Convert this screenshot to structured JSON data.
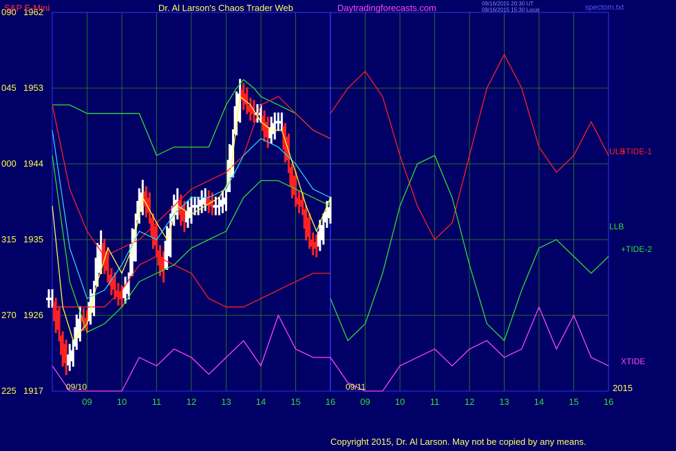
{
  "header": {
    "instrument": "S&P E-Mini",
    "site": "Dr. Al Larson's Chaos Trader Web",
    "url": "Daytradingforecasts.com",
    "timestamp_1": "09/16/2015 20:30 UT",
    "timestamp_2": "09/16/2015 15:30 Local",
    "file": "spectom.txt"
  },
  "footer": {
    "copyright": "Copyright 2015, Dr. Al Larson. May not be copied by any means."
  },
  "colors": {
    "background": "#000066",
    "grid": "#2a6a2a",
    "divider": "#3333ff",
    "price_up": "#ffffff",
    "price_down": "#ff2222",
    "red_line": "#ff2020",
    "green_line": "#33dd33",
    "cyan_line": "#33ccff",
    "yellow_line": "#ffff44",
    "magenta_line": "#ff44ff"
  },
  "chart_data": {
    "type": "line",
    "y_axis": {
      "right_labels": [
        "1962",
        "1953",
        "1944",
        "1935",
        "1926",
        "1917"
      ],
      "left_labels": [
        "090",
        "045",
        "000",
        "315",
        "270",
        "225"
      ],
      "ylim": [
        1917,
        1962
      ]
    },
    "x_axis": {
      "date_labels": [
        "09/10",
        "09/11"
      ],
      "year_label": "2015",
      "hour_labels": [
        "09",
        "10",
        "11",
        "12",
        "13",
        "14",
        "15",
        "16",
        "09",
        "10",
        "11",
        "12",
        "13",
        "14",
        "15",
        "16"
      ]
    },
    "grid": true,
    "right_labels": [
      {
        "text": "ULB",
        "color": "#ff2020"
      },
      {
        "text": "+TIDE-1",
        "color": "#ff2020"
      },
      {
        "text": "LLB",
        "color": "#33dd33"
      },
      {
        "text": "+TIDE-2",
        "color": "#33dd33"
      },
      {
        "text": "XTIDE",
        "color": "#ff44ff"
      }
    ],
    "series": [
      {
        "role": "price",
        "kind": "bars",
        "x": [
          8.0,
          8.2,
          8.4,
          8.6,
          8.8,
          9.0,
          9.2,
          9.4,
          9.6,
          9.8,
          10.0,
          10.2,
          10.4,
          10.6,
          10.8,
          11.0,
          11.2,
          11.4,
          11.6,
          11.8,
          12.0,
          12.2,
          12.4,
          12.6,
          12.8,
          13.0,
          13.2,
          13.4,
          13.6,
          13.8,
          14.0,
          14.2,
          14.4,
          14.6,
          14.8,
          15.0,
          15.2,
          15.4,
          15.6,
          15.8,
          16.0
        ],
        "y": [
          1928,
          1924,
          1920,
          1922,
          1926,
          1925,
          1929,
          1935,
          1931,
          1929,
          1928,
          1930,
          1937,
          1941,
          1938,
          1934,
          1931,
          1937,
          1940,
          1937,
          1939,
          1939,
          1940,
          1939,
          1939,
          1940,
          1947,
          1953,
          1951,
          1950,
          1950,
          1947,
          1949,
          1949,
          1944,
          1940,
          1939,
          1935,
          1934,
          1937,
          1939
        ]
      },
      {
        "role": "upper_band",
        "color": "#33dd33",
        "x": [
          8.0,
          8.5,
          9.0,
          9.5,
          10.0,
          10.5,
          11.0,
          11.5,
          12.0,
          12.5,
          13.0,
          13.3,
          13.5,
          13.8,
          14.0,
          14.5,
          15.0,
          15.5,
          16.0
        ],
        "y": [
          1951,
          1951,
          1950,
          1950,
          1950,
          1950,
          1945,
          1946,
          1946,
          1946,
          1951,
          1953,
          1954,
          1953,
          1952,
          1951,
          1950,
          1948,
          1947
        ]
      },
      {
        "role": "red_band_upper",
        "color": "#ff2020",
        "x": [
          8.0,
          8.5,
          9.0,
          9.5,
          10.0,
          10.5,
          11.0,
          11.5,
          12.0,
          12.5,
          13.0,
          13.5,
          14.0,
          14.5,
          15.0,
          15.5,
          16.0
        ],
        "y": [
          1951,
          1941,
          1936,
          1933,
          1934,
          1935,
          1937,
          1939,
          1941,
          1942,
          1943,
          1945,
          1951,
          1952,
          1950,
          1948,
          1947
        ]
      },
      {
        "role": "red_band_lower",
        "color": "#ff2020",
        "x": [
          8.0,
          8.5,
          9.0,
          9.5,
          10.0,
          10.5,
          11.0,
          11.5,
          12.0,
          12.5,
          13.0,
          13.5,
          14.0,
          14.5,
          15.0,
          15.5,
          16.0
        ],
        "y": [
          1927,
          1927,
          1927,
          1927,
          1929,
          1932,
          1933,
          1932,
          1931,
          1928,
          1927,
          1927,
          1928,
          1929,
          1930,
          1931,
          1931
        ]
      },
      {
        "role": "green_band_lower",
        "color": "#33dd33",
        "x": [
          8.0,
          8.5,
          9.0,
          9.5,
          10.0,
          10.5,
          11.0,
          11.5,
          12.0,
          12.5,
          13.0,
          13.5,
          14.0,
          14.5,
          15.0,
          15.5,
          16.0
        ],
        "y": [
          1945,
          1930,
          1924,
          1925,
          1927,
          1930,
          1931,
          1932,
          1934,
          1935,
          1936,
          1940,
          1942,
          1942,
          1941,
          1940,
          1939
        ]
      },
      {
        "role": "cyan_average",
        "color": "#33ccff",
        "x": [
          8.0,
          8.5,
          9.0,
          9.5,
          10.0,
          10.5,
          11.0,
          11.5,
          12.0,
          12.5,
          13.0,
          13.5,
          14.0,
          14.5,
          15.0,
          15.5,
          16.0
        ],
        "y": [
          1948,
          1934,
          1928,
          1929,
          1932,
          1936,
          1935,
          1938,
          1940,
          1940,
          1941,
          1945,
          1947,
          1946,
          1944,
          1941,
          1940
        ]
      },
      {
        "role": "yellow_average",
        "color": "#ffff44",
        "x": [
          8.0,
          8.3,
          8.6,
          9.0,
          9.3,
          9.6,
          10.0,
          10.3,
          10.6,
          11.0,
          11.3,
          11.6,
          12.0,
          12.4,
          12.8,
          13.1,
          13.4,
          13.7,
          14.0,
          14.3,
          14.6,
          15.0,
          15.3,
          15.6,
          16.0
        ],
        "y": [
          1939,
          1927,
          1923,
          1925,
          1930,
          1934,
          1931,
          1934,
          1940,
          1937,
          1935,
          1939,
          1938,
          1939,
          1940,
          1942,
          1952,
          1951,
          1949,
          1948,
          1948,
          1943,
          1939,
          1936,
          1940
        ]
      },
      {
        "role": "tide_1",
        "color": "#ff2020",
        "x": [
          16.0,
          16.5,
          17.0,
          17.5,
          18.0,
          18.5,
          19.0,
          19.5,
          20.0,
          20.5,
          21.0,
          21.5,
          22.0,
          22.5,
          23.0,
          23.5,
          24.0
        ],
        "y": [
          1950,
          1953,
          1955,
          1952,
          1945,
          1939,
          1935,
          1937,
          1945,
          1953,
          1957,
          1953,
          1946,
          1943,
          1945,
          1949,
          1945
        ]
      },
      {
        "role": "tide_2",
        "color": "#33dd33",
        "x": [
          16.0,
          16.5,
          17.0,
          17.5,
          18.0,
          18.5,
          19.0,
          19.5,
          20.0,
          20.5,
          21.0,
          21.5,
          22.0,
          22.5,
          23.0,
          23.5,
          24.0
        ],
        "y": [
          1928,
          1923,
          1925,
          1931,
          1939,
          1944,
          1945,
          1940,
          1932,
          1925,
          1923,
          1929,
          1934,
          1935,
          1933,
          1931,
          1933
        ]
      },
      {
        "role": "xtide",
        "color": "#ff44ff",
        "x": [
          8.0,
          8.5,
          9.0,
          9.5,
          10.0,
          10.5,
          11.0,
          11.5,
          12.0,
          12.5,
          13.0,
          13.5,
          14.0,
          14.5,
          15.0,
          15.5,
          16.0,
          16.5,
          17.0,
          17.5,
          18.0,
          18.5,
          19.0,
          19.5,
          20.0,
          20.5,
          21.0,
          21.5,
          22.0,
          22.5,
          23.0,
          23.5,
          24.0
        ],
        "y": [
          1920,
          1917,
          1917,
          1917,
          1917,
          1921,
          1920,
          1922,
          1921,
          1919,
          1921,
          1923,
          1920,
          1926,
          1922,
          1921,
          1921,
          1918,
          1917,
          1917,
          1920,
          1921,
          1922,
          1920,
          1922,
          1923,
          1921,
          1922,
          1927,
          1922,
          1926,
          1921,
          1920
        ]
      }
    ]
  }
}
